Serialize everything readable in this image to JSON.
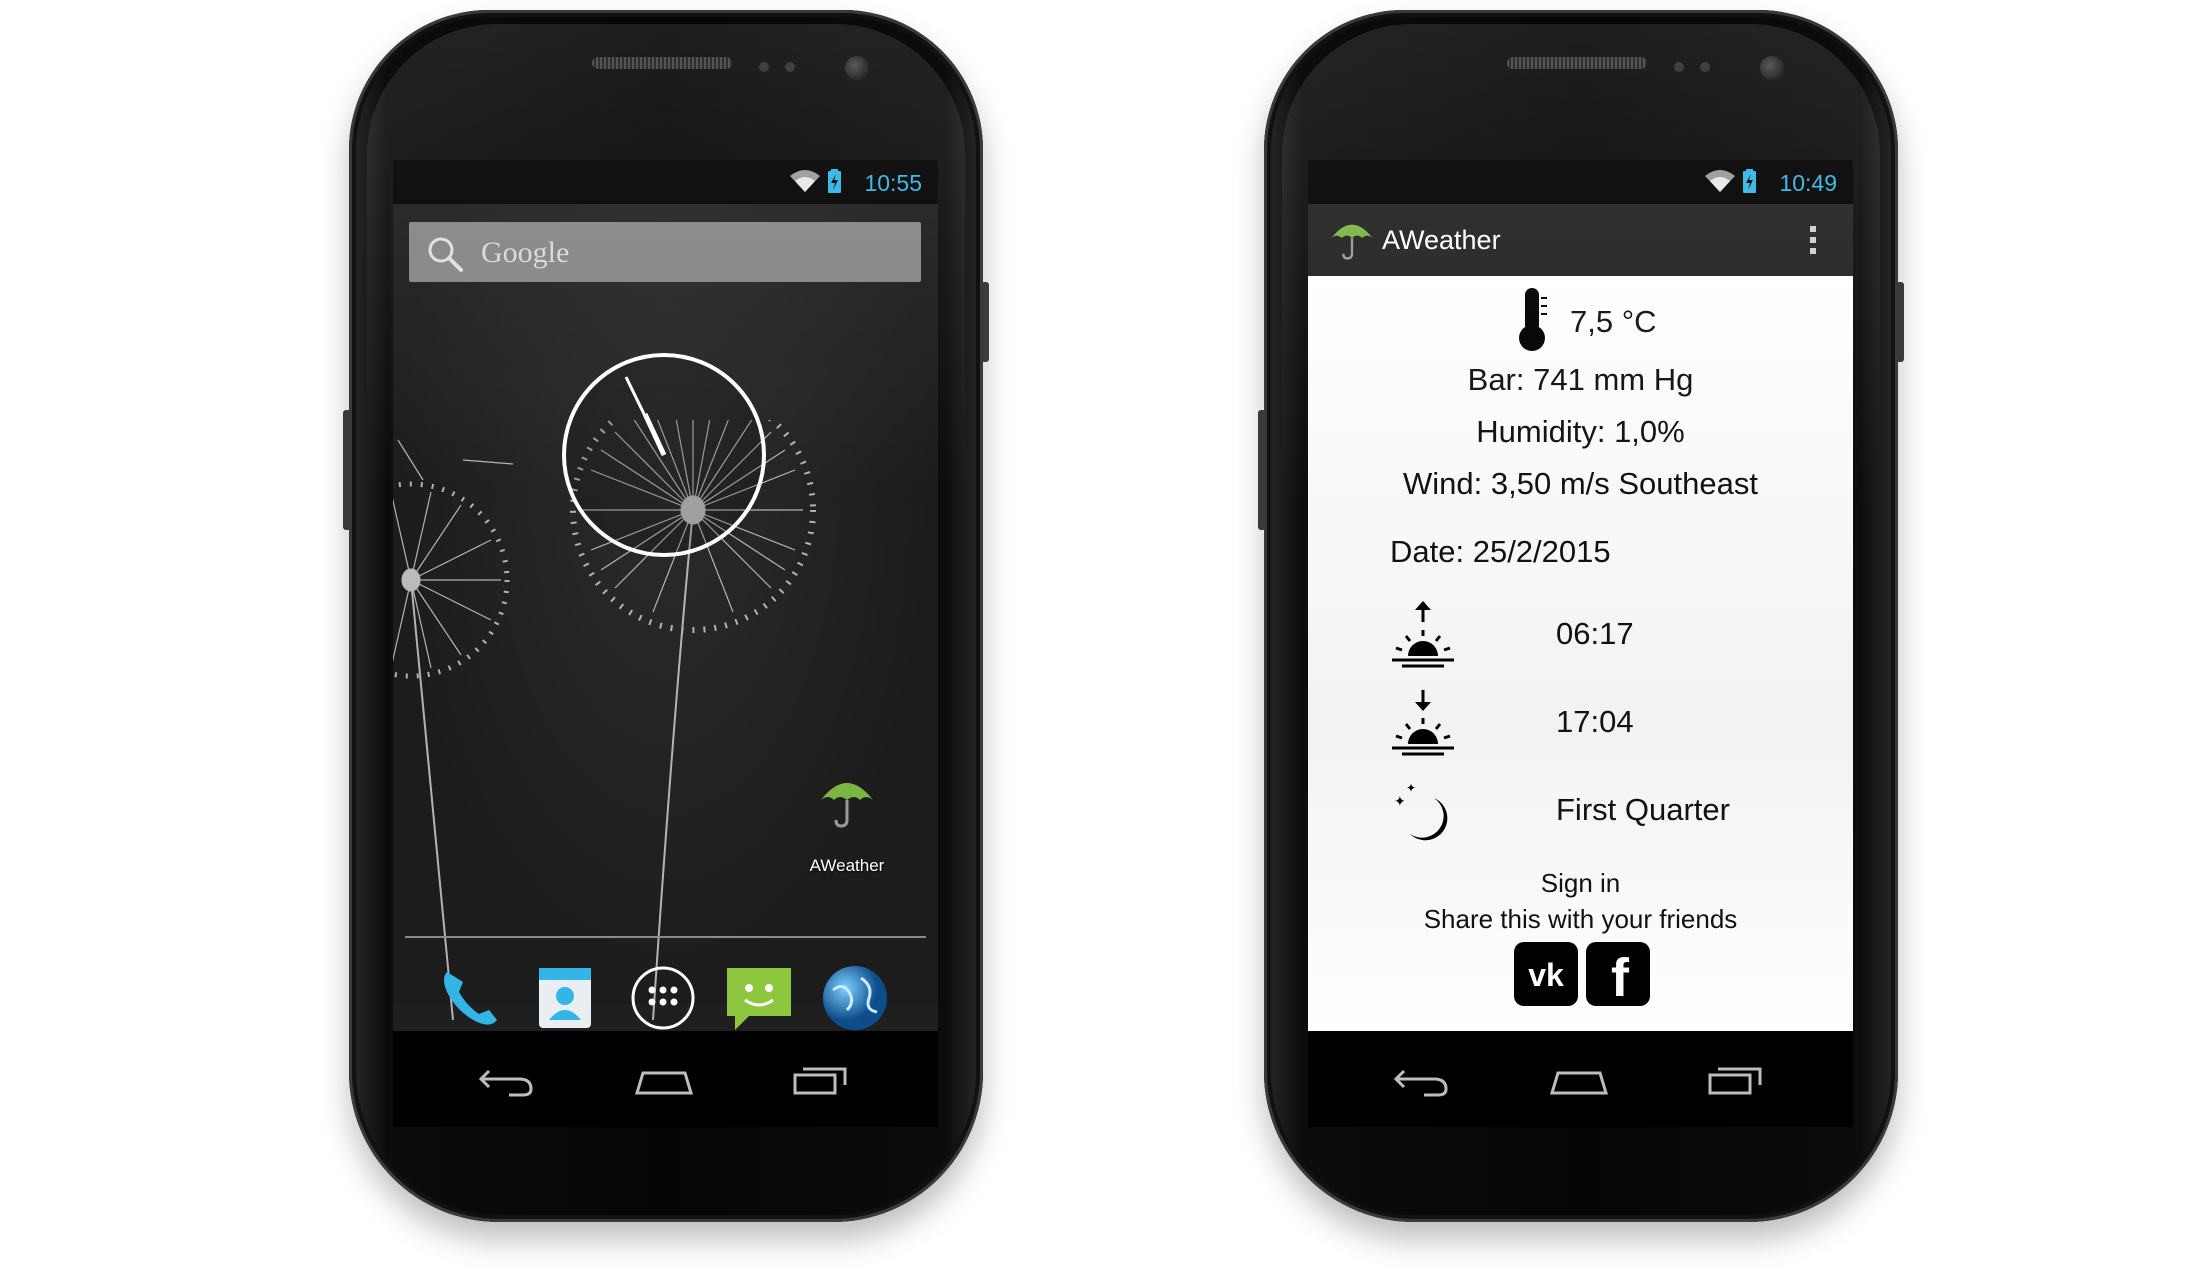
{
  "left_phone": {
    "status": {
      "time": "10:55"
    },
    "search": {
      "label": "Google"
    },
    "shortcut": {
      "label": "AWeather"
    }
  },
  "right_phone": {
    "status": {
      "time": "10:49"
    },
    "actionbar": {
      "title": "AWeather"
    },
    "weather": {
      "temperature": "7,5 °C",
      "pressure": "Bar: 741 mm Hg",
      "humidity": "Humidity: 1,0%",
      "wind": "Wind: 3,50 m/s Southeast",
      "date": "Date: 25/2/2015",
      "sunrise": "06:17",
      "sunset": "17:04",
      "moon_phase": "First Quarter"
    },
    "sign_in": "Sign in",
    "share_text": "Share this with your friends",
    "social": {
      "vk_label": "vk",
      "fb_label": "f"
    }
  },
  "colors": {
    "status_accent": "#33b5e5",
    "umbrella_green": "#7bb543",
    "screen_dark": "#1f1f1f"
  },
  "icons": [
    "wifi-icon",
    "battery-icon",
    "search-icon",
    "clock-widget",
    "umbrella-icon",
    "phone-icon",
    "contacts-icon",
    "apps-icon",
    "messaging-icon",
    "browser-icon",
    "back-icon",
    "home-icon",
    "recents-icon",
    "thermometer-icon",
    "sunrise-icon",
    "sunset-icon",
    "moon-icon",
    "vk-icon",
    "facebook-icon",
    "overflow-menu-icon"
  ]
}
